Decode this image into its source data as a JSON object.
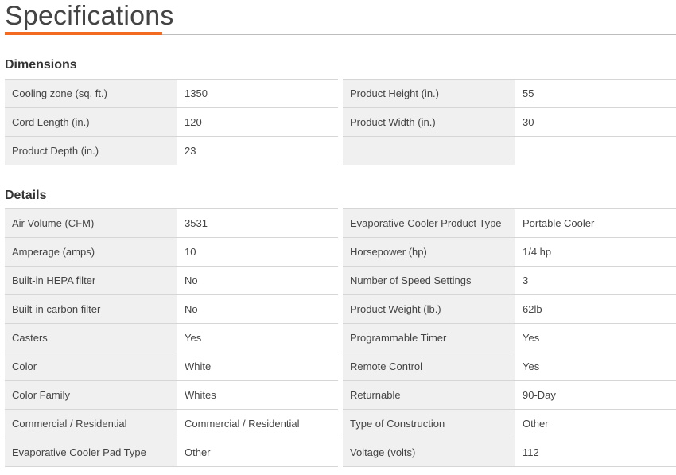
{
  "title": "Specifications",
  "sections": [
    {
      "heading": "Dimensions",
      "left": [
        {
          "label": "Cooling zone (sq. ft.)",
          "value": "1350"
        },
        {
          "label": "Cord Length (in.)",
          "value": "120"
        },
        {
          "label": "Product Depth (in.)",
          "value": "23"
        }
      ],
      "right": [
        {
          "label": "Product Height (in.)",
          "value": "55"
        },
        {
          "label": "Product Width (in.)",
          "value": "30"
        },
        {
          "label": "",
          "value": ""
        }
      ]
    },
    {
      "heading": "Details",
      "left": [
        {
          "label": "Air Volume (CFM)",
          "value": "3531"
        },
        {
          "label": "Amperage (amps)",
          "value": "10"
        },
        {
          "label": "Built-in HEPA filter",
          "value": "No"
        },
        {
          "label": "Built-in carbon filter",
          "value": "No"
        },
        {
          "label": "Casters",
          "value": "Yes"
        },
        {
          "label": "Color",
          "value": "White"
        },
        {
          "label": "Color Family",
          "value": "Whites"
        },
        {
          "label": "Commercial / Residential",
          "value": "Commercial / Residential"
        },
        {
          "label": "Evaporative Cooler Pad Type",
          "value": "Other"
        }
      ],
      "right": [
        {
          "label": "Evaporative Cooler Product Type",
          "value": "Portable Cooler"
        },
        {
          "label": "Horsepower (hp)",
          "value": "1/4 hp"
        },
        {
          "label": "Number of Speed Settings",
          "value": "3"
        },
        {
          "label": "Product Weight (lb.)",
          "value": "62lb"
        },
        {
          "label": "Programmable Timer",
          "value": "Yes"
        },
        {
          "label": "Remote Control",
          "value": "Yes"
        },
        {
          "label": "Returnable",
          "value": "90-Day"
        },
        {
          "label": "Type of Construction",
          "value": "Other"
        },
        {
          "label": "Voltage (volts)",
          "value": "112"
        }
      ]
    }
  ],
  "colors": {
    "accent": "#f26b21",
    "label_bg": "#f0f0f0",
    "rule": "#d6d6d6"
  }
}
